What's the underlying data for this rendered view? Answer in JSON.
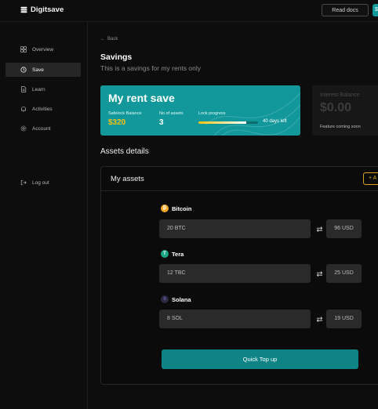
{
  "brand": {
    "name": "Digitsave",
    "icon": "stack-icon"
  },
  "header": {
    "read_docs": "Read docs"
  },
  "sidebar": {
    "items": [
      {
        "label": "Overview",
        "icon": "grid-icon"
      },
      {
        "label": "Save",
        "icon": "clock-icon",
        "active": true
      },
      {
        "label": "Learn",
        "icon": "document-icon"
      },
      {
        "label": "Activities",
        "icon": "bell-icon"
      },
      {
        "label": "Account",
        "icon": "gear-icon"
      }
    ],
    "logout": {
      "label": "Log out",
      "icon": "logout-icon"
    }
  },
  "page": {
    "back": "Back",
    "title": "Savings",
    "subtitle": "This is a savings for my rents only"
  },
  "rent_card": {
    "title": "My rent save",
    "safelock_label": "Safelock Balance",
    "safelock_value": "$320",
    "assets_label": "No of assets",
    "assets_value": "3",
    "lock_label": "Lock progress",
    "lock_progress": 0.8,
    "days_left": "40 days left"
  },
  "interest_card": {
    "label": "Interest Balance",
    "value": "$0.00",
    "note": "Feature coming soon"
  },
  "assets": {
    "heading": "Assets details",
    "panel_title": "My assets",
    "add_label": "+ A",
    "items": [
      {
        "name": "Bitcoin",
        "amount": "20 BTC",
        "usd": "96 USD",
        "color": "#f5a623",
        "glyph": "₿"
      },
      {
        "name": "Tera",
        "amount": "12 TBC",
        "usd": "25 USD",
        "color": "#1ba784",
        "glyph": "T"
      },
      {
        "name": "Solana",
        "amount": "8 SOL",
        "usd": "19 USD",
        "color": "#2b2b40",
        "glyph": "≡"
      }
    ],
    "quick_topup": "Quick Top up"
  },
  "colors": {
    "accent": "#12989a",
    "gold": "#f5c10e",
    "add_button": "#d2a01f"
  }
}
